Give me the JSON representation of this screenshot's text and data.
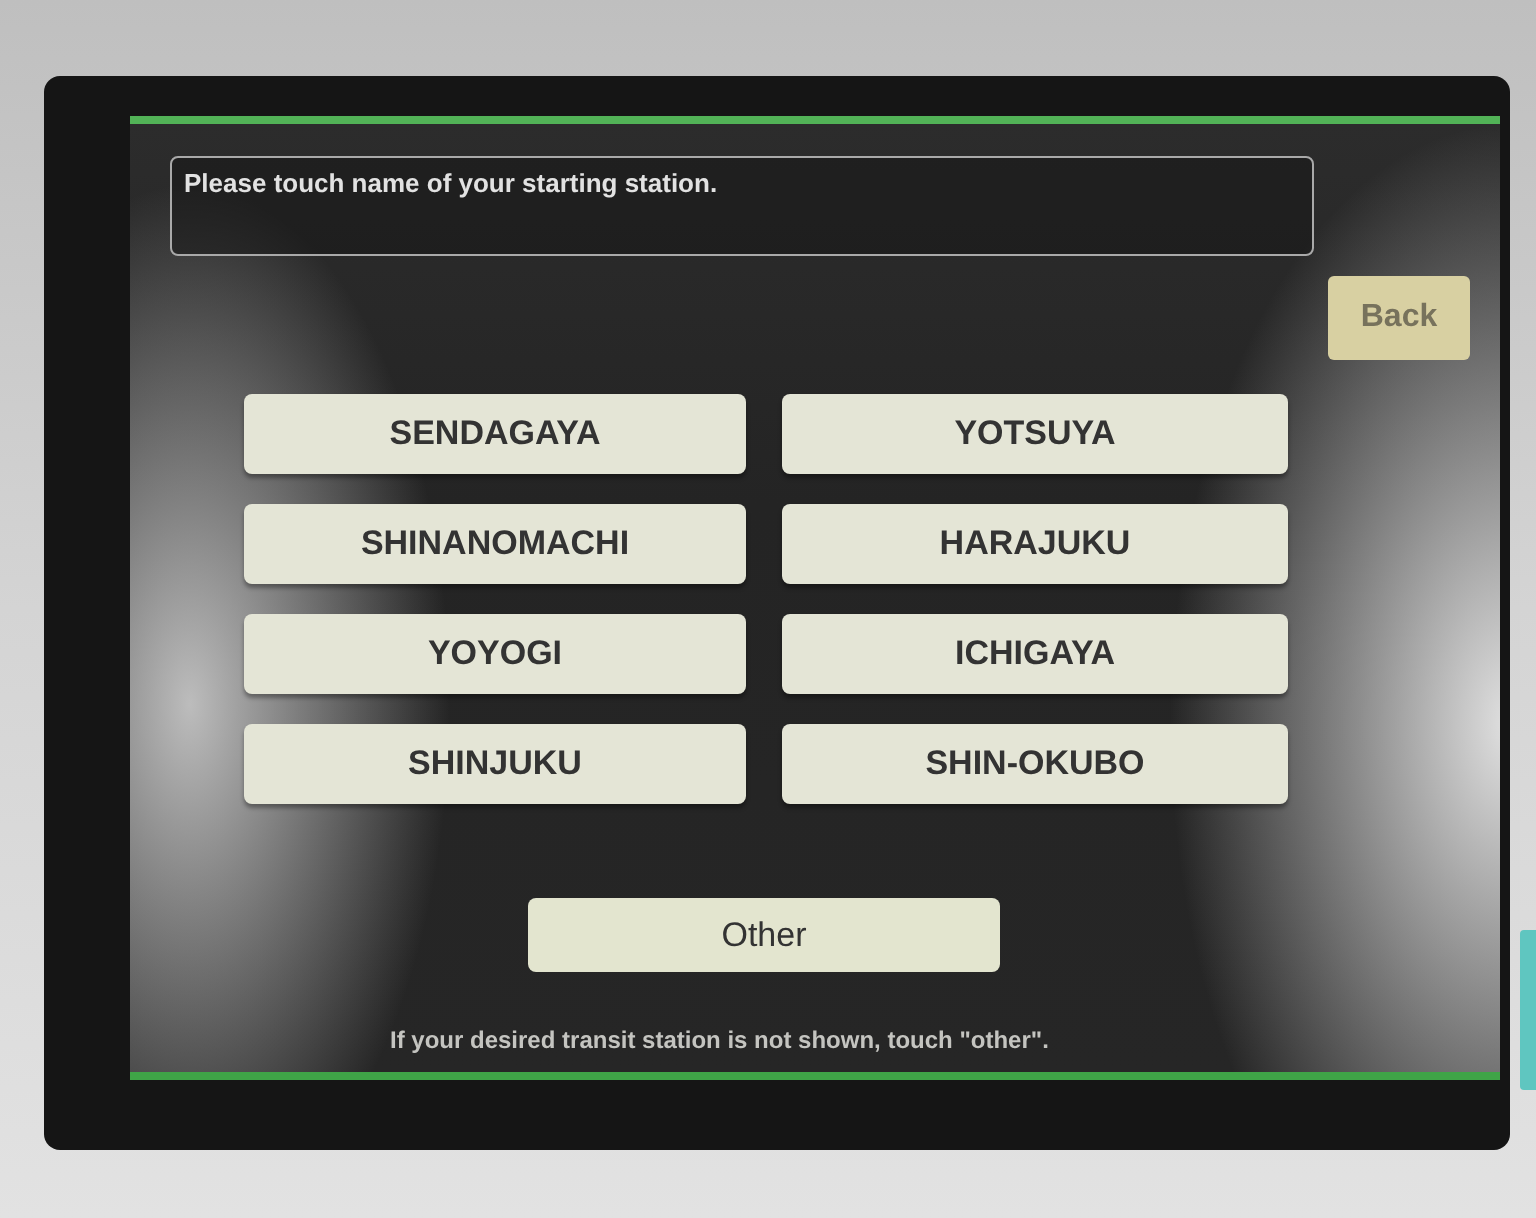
{
  "prompt": "Please touch name of your starting station.",
  "back_button": {
    "label": "Back",
    "disabled": true
  },
  "stations": [
    {
      "label": "SENDAGAYA"
    },
    {
      "label": "YOTSUYA"
    },
    {
      "label": "SHINANOMACHI"
    },
    {
      "label": "HARAJUKU"
    },
    {
      "label": "YOYOGI"
    },
    {
      "label": "ICHIGAYA"
    },
    {
      "label": "SHINJUKU"
    },
    {
      "label": "SHIN-OKUBO"
    }
  ],
  "other_button": {
    "label": "Other"
  },
  "note": "If your desired transit station is not shown, touch \"other\"."
}
